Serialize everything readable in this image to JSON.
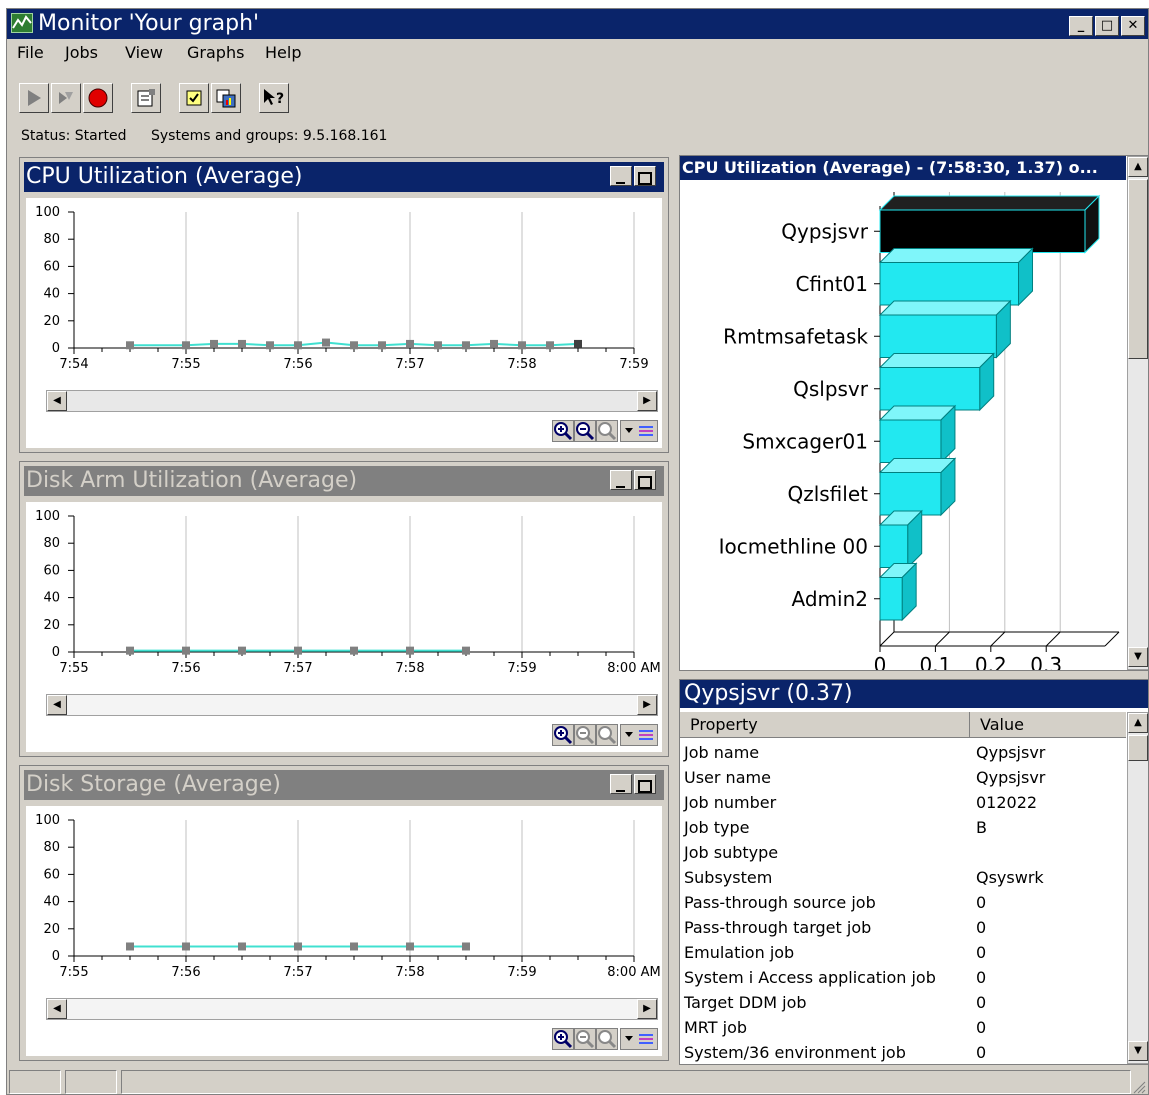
{
  "window": {
    "title": "Monitor 'Your graph'"
  },
  "menu": [
    "File",
    "Jobs",
    "View",
    "Graphs",
    "Help"
  ],
  "status": {
    "state": "Status: Started",
    "systems": "Systems and groups: 9.5.168.161"
  },
  "colors": {
    "title_active": "#0a246a",
    "series_line": "#40e0d0",
    "marker": "#808080",
    "bar_cyan": "#22e8f0",
    "bar_selected": "#000000"
  },
  "charts": [
    {
      "title": "CPU Utilization (Average)",
      "state": "active",
      "y_ticks": [
        "100",
        "80",
        "60",
        "40",
        "20",
        "0"
      ],
      "x_ticks": [
        "7:54",
        "7:55",
        "7:56",
        "7:57",
        "7:58",
        "7:59"
      ]
    },
    {
      "title": "Disk Arm Utilization (Average)",
      "state": "inactive",
      "y_ticks": [
        "100",
        "80",
        "60",
        "40",
        "20",
        "0"
      ],
      "x_ticks": [
        "7:55",
        "7:56",
        "7:57",
        "7:58",
        "7:59",
        "8:00 AM"
      ]
    },
    {
      "title": "Disk Storage (Average)",
      "state": "inactive",
      "y_ticks": [
        "100",
        "80",
        "60",
        "40",
        "20",
        "0"
      ],
      "x_ticks": [
        "7:55",
        "7:56",
        "7:57",
        "7:58",
        "7:59",
        "8:00 AM"
      ]
    }
  ],
  "chart_data": [
    {
      "type": "line",
      "title": "CPU Utilization (Average)",
      "x": [
        "7:54:30",
        "7:55:00",
        "7:55:15",
        "7:55:30",
        "7:55:45",
        "7:56:00",
        "7:56:15",
        "7:56:30",
        "7:56:45",
        "7:57:00",
        "7:57:15",
        "7:57:30",
        "7:57:45",
        "7:58:00",
        "7:58:15",
        "7:58:30"
      ],
      "values": [
        2,
        2,
        3,
        3,
        2,
        2,
        4,
        2,
        2,
        3,
        2,
        2,
        3,
        2,
        2,
        3
      ],
      "ylim": [
        0,
        100
      ],
      "xlim": [
        "7:54",
        "7:59"
      ]
    },
    {
      "type": "line",
      "title": "Disk Arm Utilization (Average)",
      "x": [
        "7:55:30",
        "7:56:00",
        "7:56:30",
        "7:57:00",
        "7:57:30",
        "7:58:00",
        "7:58:30"
      ],
      "values": [
        1,
        1,
        1,
        1,
        1,
        1,
        1
      ],
      "ylim": [
        0,
        100
      ],
      "xlim": [
        "7:55",
        "8:00 AM"
      ]
    },
    {
      "type": "line",
      "title": "Disk Storage (Average)",
      "x": [
        "7:55:30",
        "7:56:00",
        "7:56:30",
        "7:57:00",
        "7:57:30",
        "7:58:00",
        "7:58:30"
      ],
      "values": [
        7,
        7,
        7,
        7,
        7,
        7,
        7
      ],
      "ylim": [
        0,
        100
      ],
      "xlim": [
        "7:55",
        "8:00 AM"
      ]
    },
    {
      "type": "bar",
      "orientation": "horizontal",
      "title": "CPU Utilization (Average) - (7:58:30, 1.37) o...",
      "categories": [
        "Qypsjsvr",
        "Cfint01",
        "Rmtmsafetask",
        "Qslpsvr",
        "Smxcager01",
        "Qzlsfilet",
        "Iocmethline    00",
        "Admin2"
      ],
      "values": [
        0.37,
        0.25,
        0.21,
        0.18,
        0.11,
        0.11,
        0.05,
        0.04
      ],
      "x_ticks": [
        "0",
        "0.1",
        "0.2",
        "0.3"
      ],
      "xlim": [
        0,
        0.37
      ],
      "selected": "Qypsjsvr"
    }
  ],
  "details": {
    "title": "Qypsjsvr (0.37)",
    "headers": [
      "Property",
      "Value"
    ],
    "rows": [
      [
        "Job name",
        "Qypsjsvr"
      ],
      [
        "User name",
        "Qypsjsvr"
      ],
      [
        "Job number",
        "012022"
      ],
      [
        "Job type",
        "B"
      ],
      [
        "Job subtype",
        ""
      ],
      [
        "Subsystem",
        "Qsyswrk"
      ],
      [
        "Pass-through source job",
        "0"
      ],
      [
        "Pass-through target job",
        "0"
      ],
      [
        "Emulation job",
        "0"
      ],
      [
        "System i Access application job",
        "0"
      ],
      [
        "Target DDM job",
        "0"
      ],
      [
        "MRT job",
        "0"
      ],
      [
        "System/36 environment job",
        "0"
      ]
    ]
  }
}
